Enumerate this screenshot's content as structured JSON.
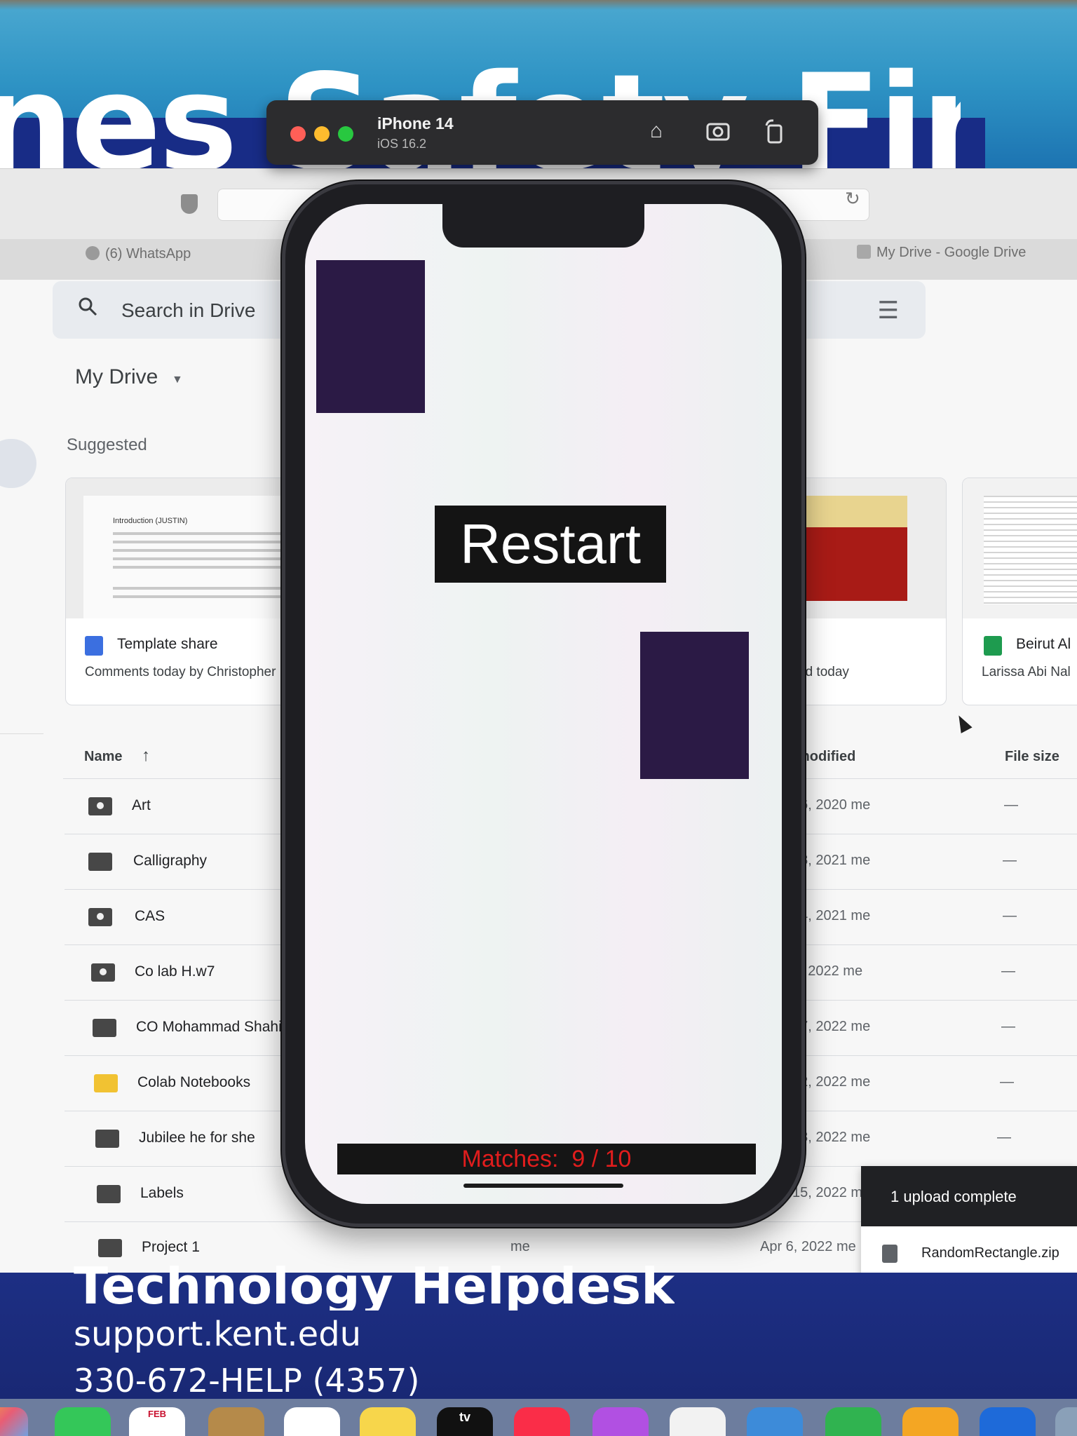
{
  "wallpaper": {
    "headline": "nes Safety First",
    "helpdesk_title": "Technology Helpdesk",
    "helpdesk_url": "support.kent.edu",
    "helpdesk_phone": "330-672-HELP (4357)"
  },
  "dock": {
    "calendar_month": "FEB",
    "tv_label": "tv"
  },
  "browser": {
    "tabs": [
      "(6) WhatsApp",
      "My Drive - Google Drive"
    ]
  },
  "drive": {
    "search_placeholder": "Search in Drive",
    "my_drive_label": "My Drive",
    "suggested_label": "Suggested",
    "suggested_cards": [
      {
        "title": "Template share",
        "subtitle": "Comments today by Christopher"
      },
      {
        "title": "",
        "subtitle": "ed today"
      },
      {
        "title": "Beirut Al",
        "subtitle": "Larissa Abi Nal"
      }
    ],
    "thumbnail_heading": "Introduction (JUSTIN)",
    "columns": {
      "name": "Name",
      "modified": "modified",
      "size": "File size"
    },
    "files": [
      {
        "name": "Art",
        "modified": "16, 2020 me",
        "size": "—"
      },
      {
        "name": "Calligraphy",
        "modified": "28, 2021 me",
        "size": "—"
      },
      {
        "name": "CAS",
        "modified": "24, 2021 me",
        "size": "—"
      },
      {
        "name": "Co lab H.w7",
        "modified": "6, 2022 me",
        "size": "—"
      },
      {
        "name": "CO Mohammad Shahin",
        "modified": "27, 2022 me",
        "size": "—"
      },
      {
        "name": "Colab Notebooks",
        "modified": "12, 2022 me",
        "size": "—"
      },
      {
        "name": "Jubilee he for she",
        "modified": "13, 2022 me",
        "size": "—"
      },
      {
        "name": "Labels",
        "modified": "15, 2022 m",
        "size": ""
      },
      {
        "name": "Project 1",
        "owner": "me",
        "modified": "Apr 6, 2022 me",
        "size": ""
      }
    ],
    "upload": {
      "title": "1 upload complete",
      "file": "RandomRectangle.zip"
    }
  },
  "simulator": {
    "device": "iPhone 14",
    "os": "iOS 16.2"
  },
  "game": {
    "restart_label": "Restart",
    "matches_text": "Matches:  9 / 10",
    "rect_color": "#2b1a45"
  }
}
